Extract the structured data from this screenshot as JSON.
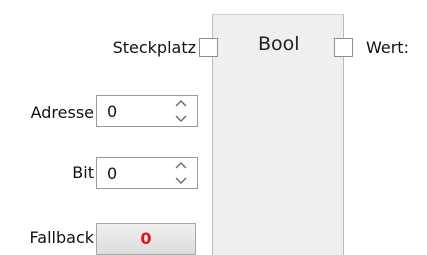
{
  "node": {
    "title": "Bool",
    "input_port_label": "Steckplatz",
    "output_port_label": "Wert:"
  },
  "fields": {
    "address": {
      "label": "Adresse",
      "value": "0"
    },
    "bit": {
      "label": "Bit",
      "value": "0"
    },
    "fallback": {
      "label": "Fallback",
      "value": "0",
      "value_color": "#e0151b"
    }
  },
  "icons": {
    "spinner_up": "chevron-up-icon",
    "spinner_down": "chevron-down-icon"
  }
}
